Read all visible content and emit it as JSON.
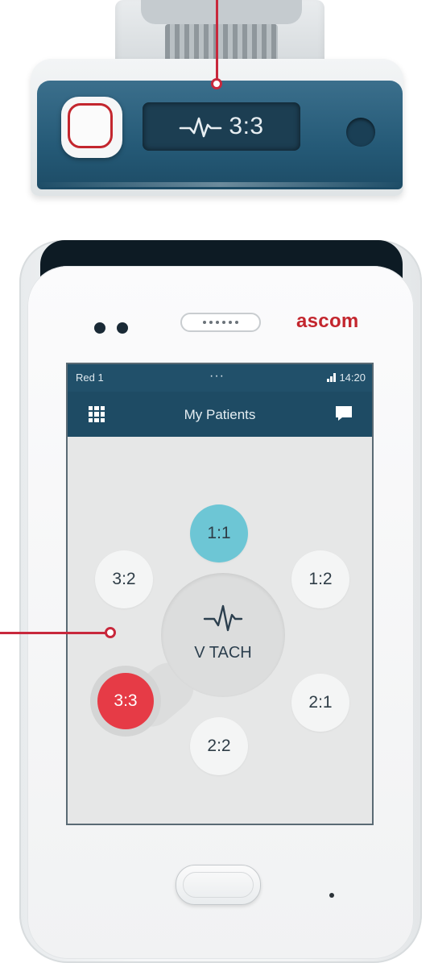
{
  "wearable": {
    "display_text": "3:3",
    "ecg_icon": "heartbeat-icon"
  },
  "handset": {
    "brand": "ascom",
    "status_bar": {
      "user": "Red 1",
      "menu": "···",
      "time": "14:20",
      "signal_icon": "signal-icon"
    },
    "app_bar": {
      "title": "My Patients",
      "menu_icon": "grid-icon",
      "message_icon": "chat-icon"
    },
    "patients": [
      {
        "label": "1:1",
        "state": "selected"
      },
      {
        "label": "1:2",
        "state": "normal"
      },
      {
        "label": "2:1",
        "state": "normal"
      },
      {
        "label": "2:2",
        "state": "normal"
      },
      {
        "label": "3:2",
        "state": "normal"
      },
      {
        "label": "3:3",
        "state": "alarm"
      }
    ],
    "alarm": {
      "label": "V TACH",
      "icon": "heartbeat-icon"
    }
  },
  "colors": {
    "accent_red": "#c3262e",
    "header_blue": "#1e4b64",
    "selected_cyan": "#6dc6d5",
    "alarm_red": "#e63b46"
  }
}
